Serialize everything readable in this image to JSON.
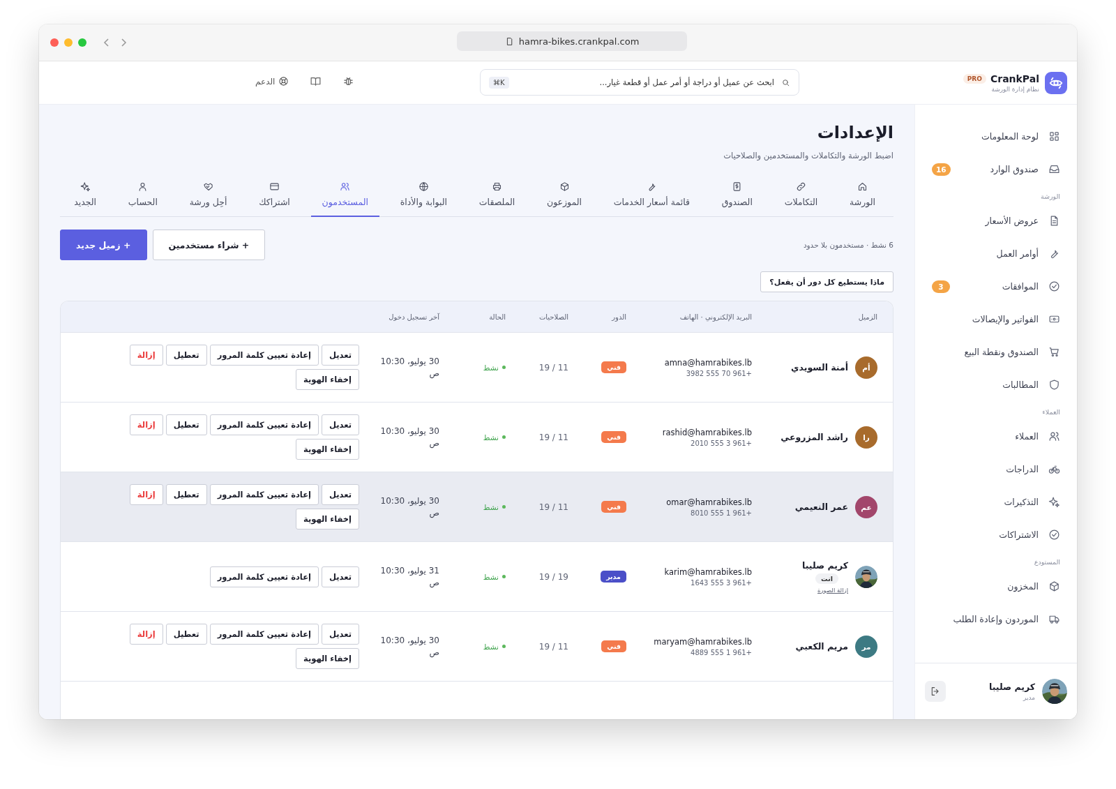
{
  "browser": {
    "url": "hamra-bikes.crankpal.com"
  },
  "brand": {
    "name": "CrankPal",
    "badge": "PRO",
    "subtitle": "نظام إدارة الورشة"
  },
  "search": {
    "placeholder": "ابحث عن عميل أو دراجة أو أمر عمل أو قطعة غيار...",
    "shortcut": "⌘K"
  },
  "toolbar": {
    "support": "الدعم"
  },
  "sidebar": {
    "sections": [
      {
        "items": [
          {
            "label": "لوحة المعلومات"
          },
          {
            "label": "صندوق الوارد",
            "badge": "16"
          }
        ]
      },
      {
        "title": "الورشة",
        "items": [
          {
            "label": "عروض الأسعار"
          },
          {
            "label": "أوامر العمل"
          },
          {
            "label": "الموافقات",
            "badge": "3"
          },
          {
            "label": "الفواتير والإيصالات"
          },
          {
            "label": "الصندوق ونقطة البيع"
          },
          {
            "label": "المطالبات"
          }
        ]
      },
      {
        "title": "العملاء",
        "items": [
          {
            "label": "العملاء"
          },
          {
            "label": "الدراجات"
          },
          {
            "label": "التذكيرات"
          },
          {
            "label": "الاشتراكات"
          }
        ]
      },
      {
        "title": "المستودع",
        "items": [
          {
            "label": "المخزون"
          },
          {
            "label": "الموردون وإعادة الطلب"
          }
        ]
      }
    ],
    "user": {
      "name": "كريم صليبا",
      "role": "مدير"
    }
  },
  "page": {
    "title": "الإعدادات",
    "subtitle": "اضبط الورشة والتكاملات والمستخدمين والصلاحيات"
  },
  "tabs": [
    {
      "label": "الورشة",
      "selected": false
    },
    {
      "label": "التكاملات",
      "selected": false
    },
    {
      "label": "الصندوق",
      "selected": false
    },
    {
      "label": "قائمة أسعار الخدمات",
      "selected": false
    },
    {
      "label": "الموزعون",
      "selected": false
    },
    {
      "label": "الملصقات",
      "selected": false
    },
    {
      "label": "البوابة والأداة",
      "selected": false
    },
    {
      "label": "المستخدمون",
      "selected": true
    },
    {
      "label": "اشتراكك",
      "selected": false
    },
    {
      "label": "أحِل ورشة",
      "selected": false
    },
    {
      "label": "الحساب",
      "selected": false
    },
    {
      "label": "الجديد",
      "selected": false
    }
  ],
  "summary": "6 نشط · مستخدمون بلا حدود",
  "buttons": [
    {
      "label": "+ شراء مستخدمين",
      "kind": "secondary"
    },
    {
      "label": "+ زميل جديد",
      "kind": "primary"
    }
  ],
  "roles_button": "ماذا يستطيع كل دور أن يفعل؟",
  "table": {
    "columns": [
      "الزميل",
      "البريد الإلكتروني · الهاتف",
      "الدور",
      "الصلاحيات",
      "الحالة",
      "آخر تسجيل دخول"
    ],
    "rows": [
      {
        "selected": false,
        "avatar": {
          "initials": "أم",
          "color": "#a86b2c"
        },
        "name": "أمنة السويدي",
        "email": "amna@hamrabikes.lb",
        "phone": "+961 70 555 3982",
        "role": {
          "label": "فني",
          "color": "#f47a4c"
        },
        "permissions": "11 / 19",
        "status": "نشط",
        "last_login": "30 يوليو، 10:30 ص",
        "actions": [
          {
            "label": "تعديل",
            "kind": "default"
          },
          {
            "label": "إعادة تعيين كلمة المرور",
            "kind": "default"
          },
          {
            "label": "تعطيل",
            "kind": "default"
          },
          {
            "label": "إزالة",
            "kind": "danger"
          },
          {
            "label": "إخفاء الهوية",
            "kind": "default"
          }
        ]
      },
      {
        "selected": false,
        "avatar": {
          "initials": "را",
          "color": "#a86b2c"
        },
        "name": "راشد المزروعي",
        "email": "rashid@hamrabikes.lb",
        "phone": "+961 3 555 2010",
        "role": {
          "label": "فني",
          "color": "#f47a4c"
        },
        "permissions": "11 / 19",
        "status": "نشط",
        "last_login": "30 يوليو، 10:30 ص",
        "actions": [
          {
            "label": "تعديل",
            "kind": "default"
          },
          {
            "label": "إعادة تعيين كلمة المرور",
            "kind": "default"
          },
          {
            "label": "تعطيل",
            "kind": "default"
          },
          {
            "label": "إزالة",
            "kind": "danger"
          },
          {
            "label": "إخفاء الهوية",
            "kind": "default"
          }
        ]
      },
      {
        "selected": true,
        "avatar": {
          "initials": "عم",
          "color": "#a2466b"
        },
        "name": "عمر النعيمي",
        "email": "omar@hamrabikes.lb",
        "phone": "+961 1 555 8010",
        "role": {
          "label": "فني",
          "color": "#f47a4c"
        },
        "permissions": "11 / 19",
        "status": "نشط",
        "last_login": "30 يوليو، 10:30 ص",
        "actions": [
          {
            "label": "تعديل",
            "kind": "default"
          },
          {
            "label": "إعادة تعيين كلمة المرور",
            "kind": "default"
          },
          {
            "label": "تعطيل",
            "kind": "default"
          },
          {
            "label": "إزالة",
            "kind": "danger"
          },
          {
            "label": "إخفاء الهوية",
            "kind": "default"
          }
        ]
      },
      {
        "selected": false,
        "name": "كريم صليبا",
        "you_badge": "انت",
        "photo_link": "إزالة الصورة",
        "email": "karim@hamrabikes.lb",
        "phone": "+961 3 555 1643",
        "role": {
          "label": "مدير",
          "color": "#4b4fc8"
        },
        "permissions": "19 / 19",
        "status": "نشط",
        "last_login": "31 يوليو، 10:30 ص",
        "actions": [
          {
            "label": "تعديل",
            "kind": "default"
          },
          {
            "label": "إعادة تعيين كلمة المرور",
            "kind": "default"
          }
        ]
      },
      {
        "selected": false,
        "avatar": {
          "initials": "مر",
          "color": "#3d7a83"
        },
        "name": "مريم الكعبي",
        "email": "maryam@hamrabikes.lb",
        "phone": "+961 1 555 4889",
        "role": {
          "label": "فني",
          "color": "#f47a4c"
        },
        "permissions": "11 / 19",
        "status": "نشط",
        "last_login": "30 يوليو، 10:30 ص",
        "actions": [
          {
            "label": "تعديل",
            "kind": "default"
          },
          {
            "label": "إعادة تعيين كلمة المرور",
            "kind": "default"
          },
          {
            "label": "تعطيل",
            "kind": "default"
          },
          {
            "label": "إزالة",
            "kind": "danger"
          },
          {
            "label": "إخفاء الهوية",
            "kind": "default"
          }
        ]
      }
    ]
  }
}
